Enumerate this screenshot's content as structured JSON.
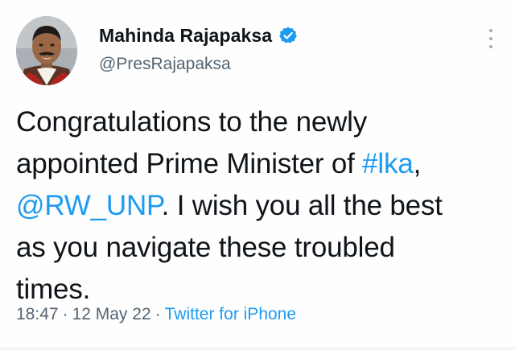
{
  "author": {
    "display_name": "Mahinda Rajapaksa",
    "handle": "@PresRajapaksa",
    "verified": true
  },
  "tweet": {
    "lines": [
      [
        {
          "text": "Congratulations to the newly",
          "type": "text"
        }
      ],
      [
        {
          "text": "appointed Prime Minister of ",
          "type": "text"
        },
        {
          "text": "#lka",
          "type": "hashtag"
        },
        {
          "text": ",",
          "type": "text"
        }
      ],
      [
        {
          "text": "@RW_UNP",
          "type": "mention"
        },
        {
          "text": ". I wish you all the best",
          "type": "text"
        }
      ],
      [
        {
          "text": "as you navigate these troubled",
          "type": "text"
        }
      ],
      [
        {
          "text": "times.",
          "type": "text"
        }
      ]
    ]
  },
  "meta": {
    "time": "18:47",
    "separator": "·",
    "date": "12 May 22",
    "source": "Twitter for iPhone"
  },
  "icons": {
    "verified": "verified-badge-icon",
    "more": "more-vertical-icon"
  },
  "colors": {
    "link": "#1d9bf0",
    "secondary_text": "#536471",
    "primary_text": "#0f1419"
  }
}
